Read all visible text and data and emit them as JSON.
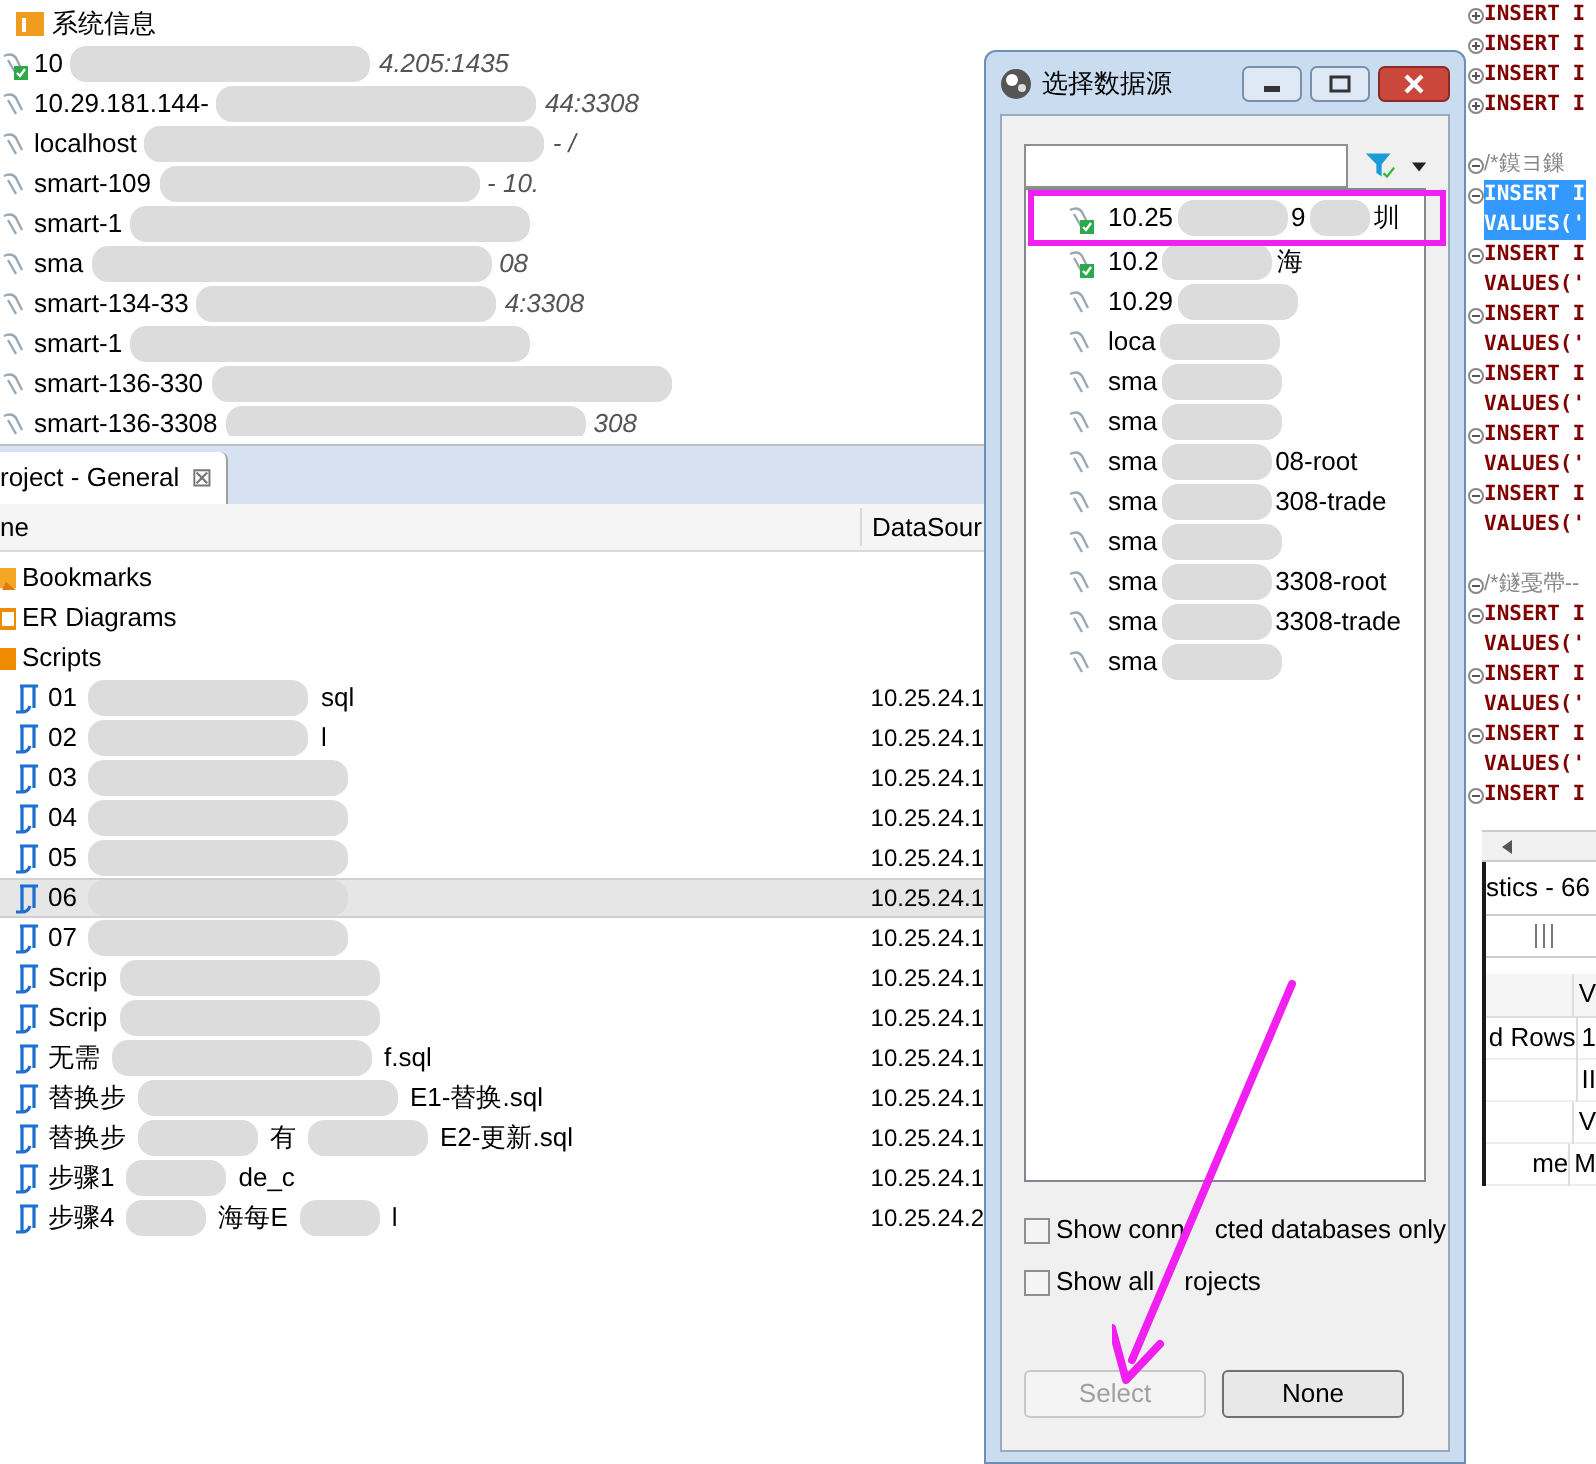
{
  "connections_tree": {
    "folder": "系统信息",
    "items": [
      {
        "parts": [
          "10"
        ],
        "detail": "4.205:1435",
        "connected": true
      },
      {
        "parts": [
          "10.29.181.144-"
        ],
        "detail": "44:3308",
        "connected": false
      },
      {
        "parts": [
          "localhost"
        ],
        "detail": "- /",
        "connected": false
      },
      {
        "parts": [
          "smart-109"
        ],
        "detail": "- 10.",
        "connected": false
      },
      {
        "parts": [
          "smart-1"
        ],
        "connected": false
      },
      {
        "parts": [
          "sma"
        ],
        "detail": "08",
        "connected": false
      },
      {
        "parts": [
          "smart-134-33"
        ],
        "detail": "4:3308",
        "connected": false
      },
      {
        "parts": [
          "smart-1"
        ],
        "connected": false
      },
      {
        "parts": [
          "smart-136-330"
        ],
        "connected": false
      },
      {
        "parts": [
          "smart-136-3308"
        ],
        "detail": "308",
        "connected": false
      }
    ]
  },
  "project_tab": {
    "label": "roject - General",
    "close": "⊠"
  },
  "project_table": {
    "columns": [
      "ne",
      "DataSour"
    ],
    "folders": [
      {
        "label": "Bookmarks",
        "kind": "bookmarks"
      },
      {
        "label": "ER Diagrams",
        "kind": "diagrams"
      },
      {
        "label": "Scripts",
        "kind": "scripts"
      }
    ],
    "scripts": [
      {
        "parts": [
          "01",
          "sql"
        ],
        "datasource": "10.25.24.1",
        "selected": false
      },
      {
        "parts": [
          "02",
          "l"
        ],
        "datasource": "10.25.24.1",
        "selected": false
      },
      {
        "parts": [
          "03"
        ],
        "datasource": "10.25.24.1",
        "selected": false
      },
      {
        "parts": [
          "04"
        ],
        "datasource": "10.25.24.1",
        "selected": false
      },
      {
        "parts": [
          "05"
        ],
        "datasource": "10.25.24.1",
        "selected": false
      },
      {
        "parts": [
          "06"
        ],
        "datasource": "10.25.24.1",
        "selected": true
      },
      {
        "parts": [
          "07"
        ],
        "datasource": "10.25.24.1",
        "selected": false
      },
      {
        "parts": [
          "Scrip"
        ],
        "datasource": "10.25.24.1",
        "selected": false
      },
      {
        "parts": [
          "Scrip"
        ],
        "datasource": "10.25.24.1",
        "selected": false
      },
      {
        "parts": [
          "无需",
          "f.sql"
        ],
        "datasource": "10.25.24.1",
        "selected": false
      },
      {
        "parts": [
          "替换步",
          "E1-替换.sql"
        ],
        "datasource": "10.25.24.1",
        "selected": false
      },
      {
        "parts": [
          "替换步",
          "有",
          "E2-更新.sql"
        ],
        "datasource": "10.25.24.1",
        "selected": false
      },
      {
        "parts": [
          "步骤1",
          "de_c"
        ],
        "datasource": "10.25.24.1",
        "selected": false
      },
      {
        "parts": [
          "步骤4",
          "海每E",
          "l"
        ],
        "datasource": "10.25.24.2",
        "selected": false
      }
    ]
  },
  "dialog": {
    "title": "选择数据源",
    "items": [
      {
        "parts": [
          "10.25",
          "9",
          "圳"
        ],
        "connected": true
      },
      {
        "parts": [
          "10.2",
          "海"
        ],
        "connected": true
      },
      {
        "parts": [
          "10.29"
        ],
        "connected": false
      },
      {
        "parts": [
          "loca"
        ],
        "connected": false
      },
      {
        "parts": [
          "sma"
        ],
        "connected": false
      },
      {
        "parts": [
          "sma"
        ],
        "connected": false
      },
      {
        "parts": [
          "sma",
          "08-root"
        ],
        "connected": false
      },
      {
        "parts": [
          "sma",
          "308-trade"
        ],
        "connected": false
      },
      {
        "parts": [
          "sma"
        ],
        "connected": false
      },
      {
        "parts": [
          "sma",
          "3308-root"
        ],
        "connected": false
      },
      {
        "parts": [
          "sma",
          "3308-trade"
        ],
        "connected": false
      },
      {
        "parts": [
          "sma"
        ],
        "connected": false
      }
    ],
    "options": [
      {
        "label": "Show conn",
        "label_after_arrow": "cted databases only",
        "checked": false
      },
      {
        "label": "Show all",
        "label_after_arrow": "rojects",
        "checked": false
      }
    ],
    "buttons": [
      {
        "label": "Select",
        "disabled": true
      },
      {
        "label": "None",
        "disabled": false
      }
    ]
  },
  "editor": {
    "lines": [
      {
        "kind": "code",
        "text": "INSERT I",
        "selected": false,
        "folded": true
      },
      {
        "kind": "code",
        "text": "INSERT I",
        "selected": false,
        "folded": true
      },
      {
        "kind": "code",
        "text": "INSERT I",
        "selected": false,
        "folded": true
      },
      {
        "kind": "code",
        "text": "INSERT I",
        "selected": false,
        "folded": true
      },
      {
        "kind": "blank"
      },
      {
        "kind": "comment",
        "text": "/*鏌ヨ鏁",
        "folded": false
      },
      {
        "kind": "code",
        "text": "INSERT I",
        "selected": true,
        "folded": false
      },
      {
        "kind": "code",
        "text": "VALUES('",
        "selected": true
      },
      {
        "kind": "code",
        "text": "INSERT I",
        "selected": false,
        "folded": false
      },
      {
        "kind": "code",
        "text": "VALUES('",
        "selected": false
      },
      {
        "kind": "code",
        "text": "INSERT I",
        "selected": false,
        "folded": false
      },
      {
        "kind": "code",
        "text": "VALUES('",
        "selected": false
      },
      {
        "kind": "code",
        "text": "INSERT I",
        "selected": false,
        "folded": false
      },
      {
        "kind": "code",
        "text": "VALUES('",
        "selected": false
      },
      {
        "kind": "code",
        "text": "INSERT I",
        "selected": false,
        "folded": false
      },
      {
        "kind": "code",
        "text": "VALUES('",
        "selected": false
      },
      {
        "kind": "code",
        "text": "INSERT I",
        "selected": false,
        "folded": false
      },
      {
        "kind": "code",
        "text": "VALUES('",
        "selected": false
      },
      {
        "kind": "blank"
      },
      {
        "kind": "comment",
        "text": "/*鐩戞帶--",
        "folded": false
      },
      {
        "kind": "code",
        "text": "INSERT I",
        "selected": false,
        "folded": false
      },
      {
        "kind": "code",
        "text": "VALUES('",
        "selected": false
      },
      {
        "kind": "code",
        "text": "INSERT I",
        "selected": false,
        "folded": false
      },
      {
        "kind": "code",
        "text": "VALUES('",
        "selected": false
      },
      {
        "kind": "code",
        "text": "INSERT I",
        "selected": false,
        "folded": false
      },
      {
        "kind": "code",
        "text": "VALUES('",
        "selected": false
      },
      {
        "kind": "code",
        "text": "INSERT I",
        "selected": false,
        "folded": false
      }
    ]
  },
  "statistics": {
    "tab": "stics - 66",
    "header": "V",
    "rows": [
      {
        "name": "d Rows",
        "value": "1"
      },
      {
        "value": "II"
      },
      {
        "value": "V"
      },
      {
        "name": "me",
        "value": "M"
      }
    ]
  }
}
